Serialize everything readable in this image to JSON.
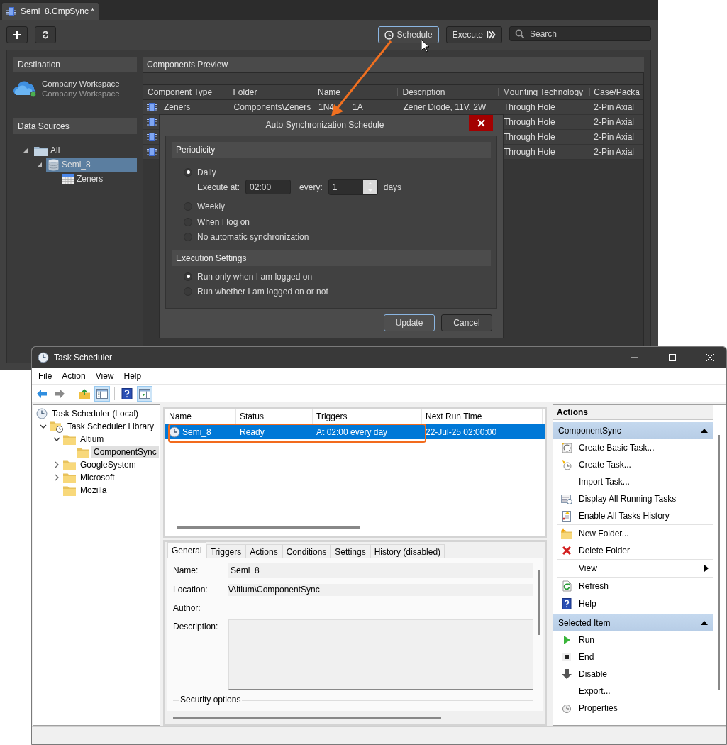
{
  "altium": {
    "document_tab": {
      "label": "Semi_8.CmpSync *",
      "selected": true
    },
    "toolbar": {
      "schedule_label": "Schedule",
      "execute_label": "Execute",
      "search": {
        "placeholder": "Search"
      }
    },
    "destination": {
      "title": "Destination",
      "workspace_name": "Company Workspace",
      "workspace_subtitle": "Company Workspace"
    },
    "data_sources": {
      "title": "Data Sources",
      "tree": [
        {
          "label": "All",
          "expandable": true,
          "expanded": true,
          "selected": false,
          "children": [
            {
              "label": "Semi_8",
              "expandable": true,
              "expanded": true,
              "selected": true,
              "children": [
                {
                  "label": "Zeners",
                  "selected": false
                }
              ]
            }
          ]
        }
      ]
    },
    "preview": {
      "title": "Components Preview",
      "columns": [
        "Component Type",
        "Folder",
        "Name",
        "Description",
        "Mounting Technology",
        "Case/Packa"
      ],
      "rows": [
        {
          "type": "Zeners",
          "folder": "Components\\Zeners",
          "name_start": "1N4",
          "name_end": "1A",
          "description": "Zener Diode, 11V, 2W",
          "mounting": "Through Hole",
          "case": "2-Pin Axial"
        },
        {
          "mounting": "Through Hole",
          "case": "2-Pin Axial"
        },
        {
          "mounting": "Through Hole",
          "case": "2-Pin Axial"
        },
        {
          "mounting": "Through Hole",
          "case": "2-Pin Axial"
        }
      ]
    }
  },
  "dialog": {
    "title": "Auto Synchronization Schedule",
    "periodicity": {
      "title": "Periodicity",
      "options": [
        {
          "label": "Daily",
          "selected": true
        },
        {
          "label": "Weekly",
          "selected": false
        },
        {
          "label": "When I log on",
          "selected": false
        },
        {
          "label": "No automatic synchronization",
          "selected": false
        }
      ],
      "execute_at_label": "Execute at:",
      "time": "02:00",
      "every_label": "every:",
      "interval": "1",
      "unit": "days"
    },
    "execution": {
      "title": "Execution Settings",
      "options": [
        {
          "label": "Run only when I am logged on",
          "selected": true
        },
        {
          "label": "Run whether I am logged on or not",
          "selected": false
        }
      ]
    },
    "buttons": [
      {
        "label": "Update",
        "focused": true
      },
      {
        "label": "Cancel",
        "focused": false
      }
    ]
  },
  "task_scheduler": {
    "title": "Task Scheduler",
    "menu": [
      "File",
      "Action",
      "View",
      "Help"
    ],
    "toolbar": [
      {
        "pressed": false
      },
      {
        "pressed": false
      },
      {
        "pressed": false
      },
      {
        "pressed": true
      },
      {
        "pressed": false
      },
      {
        "pressed": true
      }
    ],
    "tree": [
      {
        "label": "Task Scheduler (Local)",
        "selected": false,
        "children": [
          {
            "label": "Task Scheduler Library",
            "expandable": true,
            "expanded": true,
            "selected": false,
            "children": [
              {
                "label": "Altium",
                "expandable": true,
                "expanded": true,
                "selected": false,
                "children": [
                  {
                    "label": "ComponentSync",
                    "selected": true
                  }
                ]
              },
              {
                "label": "GoogleSystem",
                "expandable": true,
                "expanded": false,
                "selected": false
              },
              {
                "label": "Microsoft",
                "expandable": true,
                "expanded": false,
                "selected": false
              },
              {
                "label": "Mozilla",
                "selected": false
              }
            ]
          }
        ]
      }
    ],
    "tasks": {
      "columns": [
        "Name",
        "Status",
        "Triggers",
        "Next Run Time"
      ],
      "rows": [
        {
          "name": "Semi_8",
          "status": "Ready",
          "triggers": "At 02:00 every day",
          "next_run": "22-Jul-25 02:00:00",
          "selected": true
        }
      ]
    },
    "detail_tabs": [
      {
        "label": "General",
        "selected": true
      },
      {
        "label": "Triggers",
        "selected": false
      },
      {
        "label": "Actions",
        "selected": false
      },
      {
        "label": "Conditions",
        "selected": false
      },
      {
        "label": "Settings",
        "selected": false
      },
      {
        "label": "History (disabled)",
        "selected": false
      }
    ],
    "general": {
      "name_label": "Name:",
      "name": "Semi_8",
      "location_label": "Location:",
      "location": "\\Altium\\ComponentSync",
      "author_label": "Author:",
      "description_label": "Description:",
      "security_label": "Security options"
    },
    "actions": {
      "title": "Actions",
      "groups": [
        {
          "title": "ComponentSync",
          "expanded": true,
          "items": [
            {
              "label": "Create Basic Task...",
              "kind": "command",
              "divider_above": false
            },
            {
              "label": "Create Task...",
              "kind": "command",
              "divider_above": false
            },
            {
              "label": "Import Task...",
              "kind": "command",
              "divider_above": false
            },
            {
              "label": "Display All Running Tasks",
              "kind": "command",
              "divider_above": false
            },
            {
              "label": "Enable All Tasks History",
              "kind": "command",
              "divider_above": false
            },
            {
              "label": "New Folder...",
              "kind": "command",
              "divider_above": true
            },
            {
              "label": "Delete Folder",
              "kind": "command",
              "divider_above": false
            },
            {
              "label": "View",
              "kind": "submenu",
              "divider_above": true
            },
            {
              "label": "Refresh",
              "kind": "command",
              "divider_above": true
            },
            {
              "label": "Help",
              "kind": "command",
              "divider_above": true
            }
          ]
        },
        {
          "title": "Selected Item",
          "expanded": true,
          "items": [
            {
              "label": "Run",
              "kind": "command",
              "divider_above": false
            },
            {
              "label": "End",
              "kind": "command",
              "divider_above": false
            },
            {
              "label": "Disable",
              "kind": "command",
              "divider_above": false
            },
            {
              "label": "Export...",
              "kind": "command",
              "divider_above": false
            },
            {
              "label": "Properties",
              "kind": "command",
              "divider_above": false
            }
          ]
        }
      ]
    }
  }
}
